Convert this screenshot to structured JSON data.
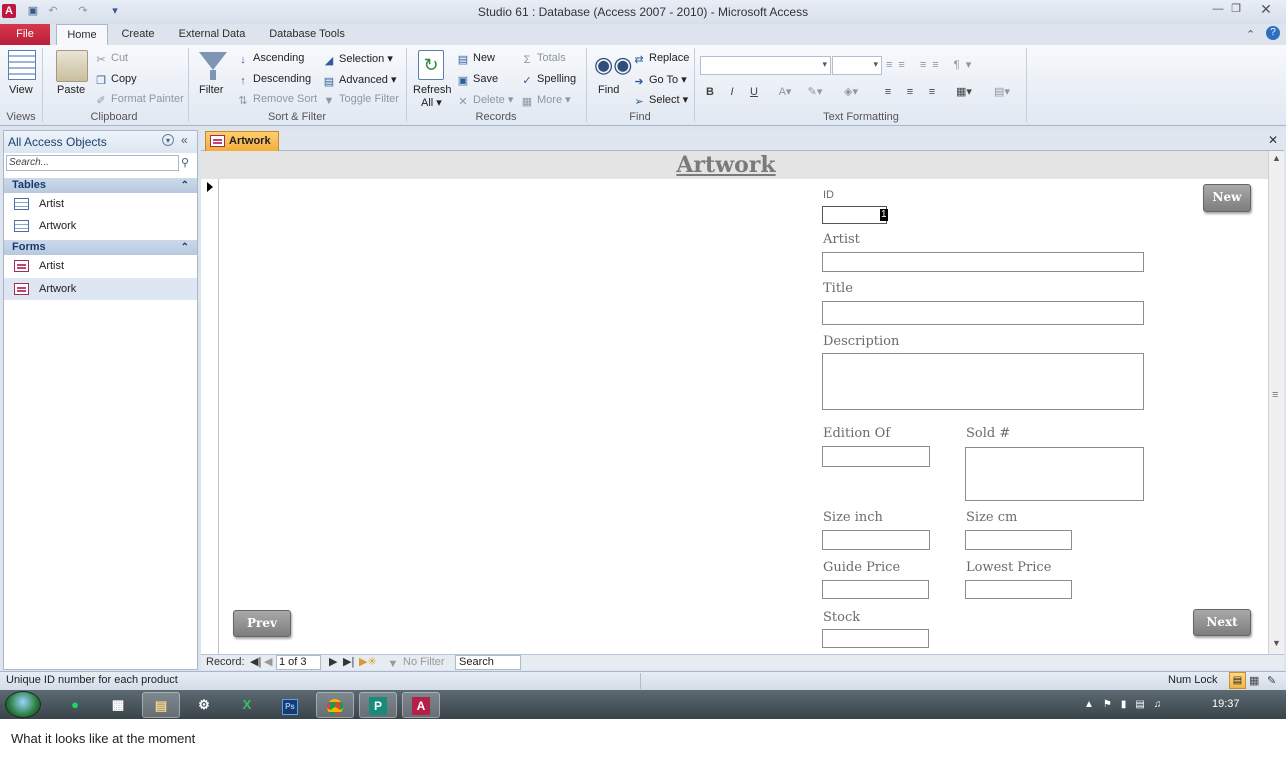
{
  "window": {
    "title": "Studio 61 : Database (Access 2007 - 2010)  -  Microsoft Access",
    "app_icon": "A"
  },
  "ribbon": {
    "tabs": [
      "File",
      "Home",
      "Create",
      "External Data",
      "Database Tools"
    ],
    "views": {
      "view": "View",
      "label": "Views"
    },
    "clipboard": {
      "paste": "Paste",
      "cut": "Cut",
      "copy": "Copy",
      "format_painter": "Format Painter",
      "label": "Clipboard"
    },
    "sort_filter": {
      "filter": "Filter",
      "ascending": "Ascending",
      "descending": "Descending",
      "remove_sort": "Remove Sort",
      "selection": "Selection",
      "advanced": "Advanced",
      "toggle_filter": "Toggle Filter",
      "label": "Sort & Filter"
    },
    "records": {
      "refresh": "Refresh",
      "refresh_sub": "All",
      "new": "New",
      "save": "Save",
      "delete": "Delete",
      "totals": "Totals",
      "spelling": "Spelling",
      "more": "More",
      "label": "Records"
    },
    "find": {
      "find": "Find",
      "replace": "Replace",
      "go_to": "Go To",
      "select": "Select",
      "label": "Find"
    },
    "text_formatting": {
      "label": "Text Formatting"
    }
  },
  "nav_pane": {
    "title": "All Access Objects",
    "search_placeholder": "Search...",
    "tables_header": "Tables",
    "tables": [
      "Artist",
      "Artwork"
    ],
    "forms_header": "Forms",
    "forms": [
      "Artist",
      "Artwork"
    ]
  },
  "document": {
    "tab_label": "Artwork",
    "form_title": "Artwork",
    "fields": {
      "id": {
        "label": "ID",
        "value": "1"
      },
      "artist": "Artist",
      "title": "Title",
      "description": "Description",
      "edition_of": "Edition Of",
      "sold": "Sold #",
      "size_inch": "Size inch",
      "size_cm": "Size cm",
      "guide_price": "Guide Price",
      "lowest_price": "Lowest Price",
      "stock": "Stock"
    },
    "buttons": {
      "new": "New",
      "prev": "Prev",
      "next": "Next"
    }
  },
  "record_nav": {
    "label": "Record:",
    "position": "1 of 3",
    "filter": "No Filter",
    "search": "Search"
  },
  "status": {
    "message": "Unique ID number for each product",
    "num_lock": "Num Lock"
  },
  "taskbar": {
    "apps": [
      "spotify-icon",
      "calculator-icon",
      "explorer-icon",
      "steam-icon",
      "excel-icon",
      "photoshop-icon",
      "chrome-icon",
      "publisher-icon",
      "access-icon"
    ],
    "clock": "19:37"
  },
  "caption": "What it looks like at the moment"
}
